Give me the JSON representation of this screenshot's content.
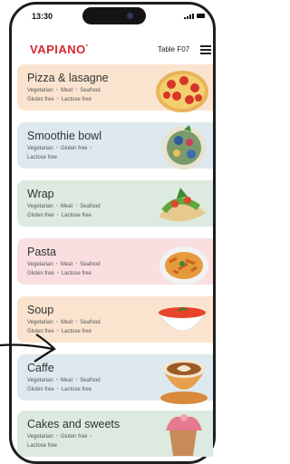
{
  "status": {
    "time": "13:30"
  },
  "header": {
    "logo": "VAPIANO",
    "logo_mark": "°",
    "table": "Table F07"
  },
  "categories": [
    {
      "title": "Pizza & lasagne",
      "tags": [
        "Vegetarian",
        "Meat",
        "Seafood",
        "Gluten free",
        "Lactose free"
      ],
      "bg": "#fbe4cf",
      "icon": "pizza-icon"
    },
    {
      "title": "Smoothie bowl",
      "tags": [
        "Vegetarian",
        "Gluten free",
        "Lactose free"
      ],
      "bg": "#dde9ee",
      "icon": "smoothie-bowl-icon"
    },
    {
      "title": "Wrap",
      "tags": [
        "Vegetarian",
        "Meat",
        "Seafood",
        "Gluten free",
        "Lactose free"
      ],
      "bg": "#dceadf",
      "icon": "wrap-icon"
    },
    {
      "title": "Pasta",
      "tags": [
        "Vegetarian",
        "Meat",
        "Seafood",
        "Gluten free",
        "Lactose free"
      ],
      "bg": "#f9dfe0",
      "icon": "pasta-icon"
    },
    {
      "title": "Soup",
      "tags": [
        "Vegetarian",
        "Meat",
        "Seafood",
        "Gluten free",
        "Lactose free"
      ],
      "bg": "#fbe4cf",
      "icon": "soup-icon"
    },
    {
      "title": "Caffe",
      "tags": [
        "Vegetarian",
        "Meat",
        "Seafood",
        "Gluten free",
        "Lactose free"
      ],
      "bg": "#dde9ee",
      "icon": "coffee-icon"
    },
    {
      "title": "Cakes and sweets",
      "tags": [
        "Vegetarian",
        "Gluten free",
        "Lactose free"
      ],
      "bg": "#dceadf",
      "icon": "cupcake-icon"
    }
  ],
  "colors": {
    "brand": "#d9272e",
    "text": "#333333"
  }
}
